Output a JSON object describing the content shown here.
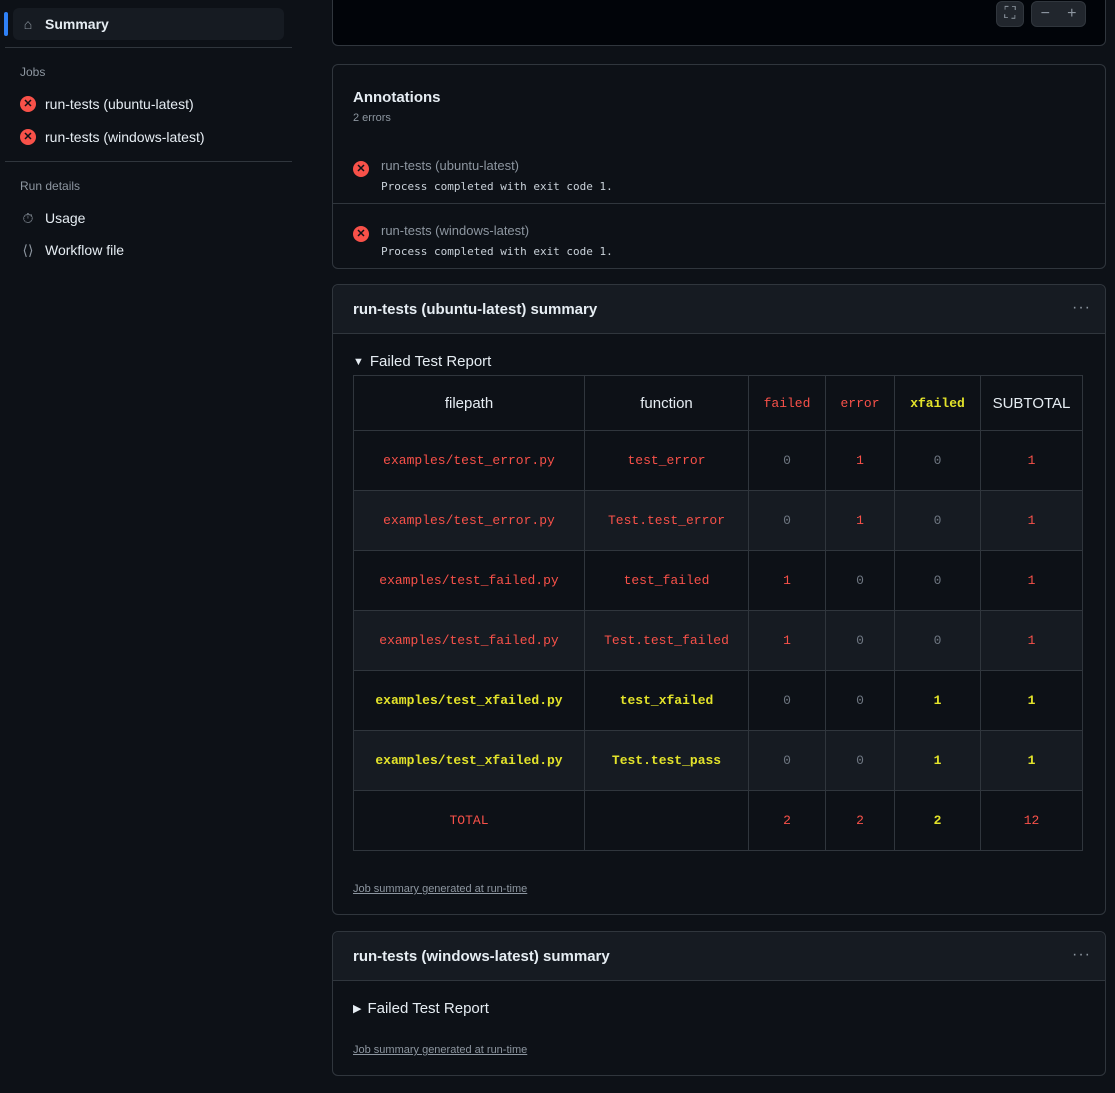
{
  "sidebar": {
    "summary": "Summary",
    "jobs_heading": "Jobs",
    "jobs": [
      "run-tests (ubuntu-latest)",
      "run-tests (windows-latest)"
    ],
    "run_details_heading": "Run details",
    "usage": "Usage",
    "workflow_file": "Workflow file"
  },
  "annotations": {
    "title": "Annotations",
    "count": "2 errors",
    "items": [
      {
        "job": "run-tests (ubuntu-latest)",
        "message": "Process completed with exit code 1."
      },
      {
        "job": "run-tests (windows-latest)",
        "message": "Process completed with exit code 1."
      }
    ]
  },
  "summaries": [
    {
      "title": "run-tests (ubuntu-latest) summary",
      "details": "Failed Test Report",
      "footer": "Job summary generated at run-time"
    },
    {
      "title": "run-tests (windows-latest) summary",
      "details": "Failed Test Report",
      "footer": "Job summary generated at run-time"
    }
  ],
  "colors": {
    "failed": "#f85149",
    "xfailed": "#e3e32a",
    "accent": "#2f81f7"
  },
  "table": {
    "headers": [
      "filepath",
      "function",
      "failed",
      "error",
      "xfailed",
      "SUBTOTAL"
    ],
    "rows": [
      {
        "status": "red",
        "cells": [
          "examples/test_error.py",
          "test_error",
          "0",
          "1",
          "0",
          "1"
        ]
      },
      {
        "status": "red",
        "cells": [
          "examples/test_error.py",
          "Test.test_error",
          "0",
          "1",
          "0",
          "1"
        ]
      },
      {
        "status": "red",
        "cells": [
          "examples/test_failed.py",
          "test_failed",
          "1",
          "0",
          "0",
          "1"
        ]
      },
      {
        "status": "red",
        "cells": [
          "examples/test_failed.py",
          "Test.test_failed",
          "1",
          "0",
          "0",
          "1"
        ]
      },
      {
        "status": "yel",
        "cells": [
          "examples/test_xfailed.py",
          "test_xfailed",
          "0",
          "0",
          "1",
          "1"
        ]
      },
      {
        "status": "yel",
        "cells": [
          "examples/test_xfailed.py",
          "Test.test_pass",
          "0",
          "0",
          "1",
          "1"
        ]
      }
    ],
    "total": [
      "TOTAL",
      "",
      "2",
      "2",
      "2",
      "12"
    ]
  }
}
